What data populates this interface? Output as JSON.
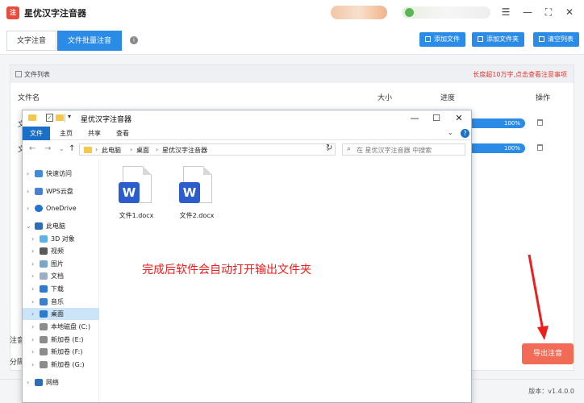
{
  "app": {
    "title": "星优汉字注音器",
    "tabs": [
      "文字注音",
      "文件批量注音"
    ],
    "toolbar": {
      "add_file": "添加文件",
      "add_folder": "添加文件夹",
      "clear_list": "清空列表"
    },
    "file_list": {
      "title": "文件列表",
      "tip": "长度超10万字,点击查看注意事项",
      "columns": {
        "name": "文件名",
        "size": "大小",
        "progress": "进度",
        "action": "操作"
      },
      "rows": [
        {
          "name_stub": "文",
          "progress_label": "100%",
          "progress": 1.0
        },
        {
          "name_stub": "文",
          "progress_label": "100%",
          "progress": 1.0
        }
      ]
    },
    "side_labels": [
      "注音",
      "分隔"
    ],
    "export_button": "导出注音",
    "version": "版本：v1.4.0.0"
  },
  "explorer": {
    "title": "星优汉字注音器",
    "ribbon_tabs": [
      "文件",
      "主页",
      "共享",
      "查看"
    ],
    "breadcrumb": [
      "此电脑",
      "桌面",
      "星优汉字注音器"
    ],
    "search_placeholder": "在 星优汉字注音器 中搜索",
    "nav": [
      {
        "label": "快速访问",
        "icon": "star-icon"
      },
      {
        "label": "WPS云盘",
        "icon": "cloud-icon"
      },
      {
        "label": "OneDrive",
        "icon": "onedrive-icon"
      },
      {
        "label": "此电脑",
        "icon": "computer-icon"
      },
      {
        "label": "3D 对象",
        "icon": "cube-icon"
      },
      {
        "label": "视频",
        "icon": "video-icon"
      },
      {
        "label": "图片",
        "icon": "picture-icon"
      },
      {
        "label": "文档",
        "icon": "document-icon"
      },
      {
        "label": "下载",
        "icon": "download-icon"
      },
      {
        "label": "音乐",
        "icon": "music-icon"
      },
      {
        "label": "桌面",
        "icon": "desktop-icon"
      },
      {
        "label": "本地磁盘 (C:)",
        "icon": "drive-icon"
      },
      {
        "label": "新加卷 (E:)",
        "icon": "drive-icon"
      },
      {
        "label": "新加卷 (F:)",
        "icon": "drive-icon"
      },
      {
        "label": "新加卷 (G:)",
        "icon": "drive-icon"
      },
      {
        "label": "网络",
        "icon": "network-icon"
      }
    ],
    "files": [
      "文件1.docx",
      "文件2.docx"
    ],
    "annotation": "完成后软件会自动打开输出文件夹"
  },
  "colors": {
    "accent": "#2b8ce8",
    "export": "#f26b57",
    "annotation": "#ee1e1e",
    "word": "#2b5dcf"
  }
}
